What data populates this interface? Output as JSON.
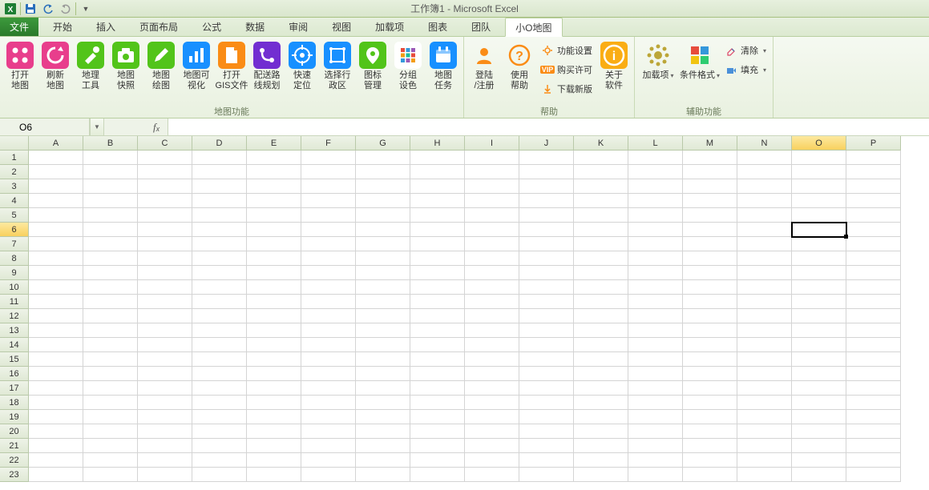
{
  "title": "工作簿1 - Microsoft Excel",
  "tabs": {
    "file": "文件",
    "list": [
      "开始",
      "插入",
      "页面布局",
      "公式",
      "数据",
      "审阅",
      "视图",
      "加载项",
      "图表",
      "团队",
      "小O地图"
    ],
    "active_index": 10
  },
  "ribbon": {
    "group_map": {
      "label": "地图功能",
      "items": [
        {
          "l1": "打开",
          "l2": "地图",
          "color": "#e83e8c",
          "icon": "apps"
        },
        {
          "l1": "刷新",
          "l2": "地图",
          "color": "#e83e8c",
          "icon": "refresh"
        },
        {
          "l1": "地理",
          "l2": "工具",
          "color": "#52c41a",
          "icon": "tools"
        },
        {
          "l1": "地图",
          "l2": "快照",
          "color": "#52c41a",
          "icon": "camera"
        },
        {
          "l1": "地图",
          "l2": "绘图",
          "color": "#52c41a",
          "icon": "pencil"
        },
        {
          "l1": "地图可",
          "l2": "视化",
          "color": "#1890ff",
          "icon": "chart"
        },
        {
          "l1": "打开",
          "l2": "GIS文件",
          "color": "#fa8c16",
          "icon": "file"
        },
        {
          "l1": "配送路",
          "l2": "线规划",
          "color": "#722ed1",
          "icon": "route"
        },
        {
          "l1": "快速",
          "l2": "定位",
          "color": "#1890ff",
          "icon": "target"
        },
        {
          "l1": "选择行",
          "l2": "政区",
          "color": "#1890ff",
          "icon": "region"
        },
        {
          "l1": "图标",
          "l2": "管理",
          "color": "#52c41a",
          "icon": "pin"
        },
        {
          "l1": "分组",
          "l2": "设色",
          "color": "#722ed1",
          "icon": "grid"
        },
        {
          "l1": "地图",
          "l2": "任务",
          "color": "#1890ff",
          "icon": "calendar"
        }
      ]
    },
    "group_help": {
      "label": "帮助",
      "items": [
        {
          "l1": "登陆",
          "l2": "/注册",
          "color": "#fa8c16",
          "icon": "user"
        },
        {
          "l1": "使用",
          "l2": "帮助",
          "color": "#fa8c16",
          "icon": "help"
        }
      ],
      "small": [
        {
          "label": "功能设置",
          "icon": "gear",
          "color": "#fa8c16"
        },
        {
          "label": "购买许可",
          "icon": "vip",
          "color": "#fa8c16"
        },
        {
          "label": "下载新版",
          "icon": "download",
          "color": "#fa8c16"
        }
      ],
      "about": {
        "l1": "关于",
        "l2": "软件",
        "color": "#faad14",
        "icon": "info"
      }
    },
    "group_aux": {
      "label": "辅助功能",
      "items": [
        {
          "l1": "加载项",
          "l2": "",
          "color": "#bca638",
          "icon": "addin"
        },
        {
          "l1": "条件格式",
          "l2": "",
          "color": "#4b74c5",
          "icon": "condfmt"
        }
      ],
      "small": [
        {
          "label": "清除",
          "icon": "eraser"
        },
        {
          "label": "填充",
          "icon": "fill"
        }
      ]
    }
  },
  "namebox": "O6",
  "formula": "",
  "columns": [
    "A",
    "B",
    "C",
    "D",
    "E",
    "F",
    "G",
    "H",
    "I",
    "J",
    "K",
    "L",
    "M",
    "N",
    "O",
    "P"
  ],
  "rows": 23,
  "selected": {
    "col_index": 14,
    "row_index": 5,
    "col": "O",
    "row": 6
  }
}
